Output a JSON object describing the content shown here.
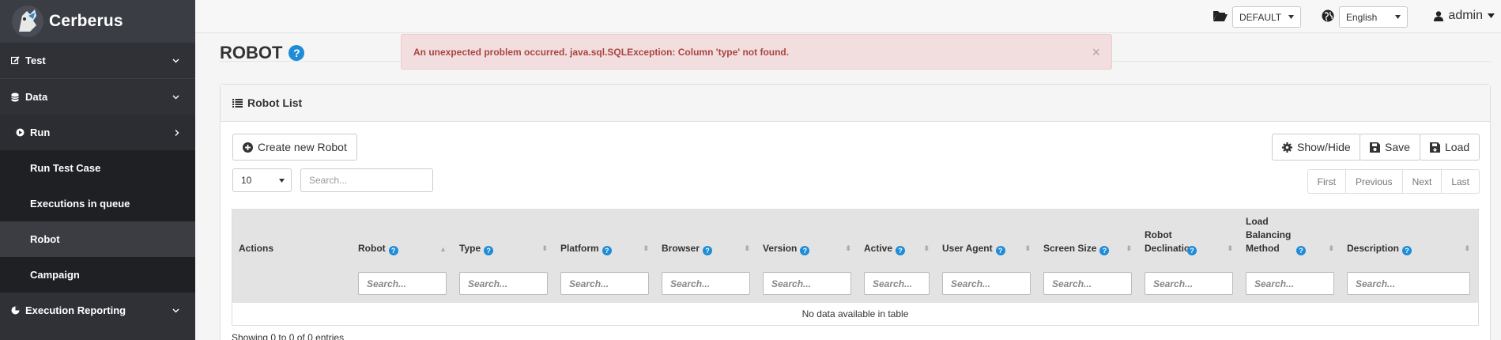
{
  "app": {
    "name": "Cerberus"
  },
  "sidebar": {
    "items": [
      {
        "label": "Test"
      },
      {
        "label": "Data"
      },
      {
        "label": "Run"
      },
      {
        "label": "Run Test Case"
      },
      {
        "label": "Executions in queue"
      },
      {
        "label": "Robot"
      },
      {
        "label": "Campaign"
      },
      {
        "label": "Execution Reporting"
      }
    ]
  },
  "topbar": {
    "system": "DEFAULT",
    "language": "English",
    "user": "admin"
  },
  "page": {
    "title": "ROBOT"
  },
  "alert": {
    "message": "An unexpected problem occurred. java.sql.SQLException: Column 'type' not found.",
    "close": "×"
  },
  "panel": {
    "title": "Robot List",
    "create_button": "Create new Robot",
    "showhide_button": "Show/Hide",
    "save_button": "Save",
    "load_button": "Load",
    "page_size": "10",
    "search_placeholder": "Search...",
    "pager": {
      "first": "First",
      "previous": "Previous",
      "next": "Next",
      "last": "Last"
    }
  },
  "table": {
    "columns": [
      {
        "label": "Actions",
        "help": false
      },
      {
        "label": "Robot",
        "help": true
      },
      {
        "label": "Type",
        "help": true
      },
      {
        "label": "Platform",
        "help": true
      },
      {
        "label": "Browser",
        "help": true
      },
      {
        "label": "Version",
        "help": true
      },
      {
        "label": "Active",
        "help": true
      },
      {
        "label": "User Agent",
        "help": true
      },
      {
        "label": "Screen Size",
        "help": true
      },
      {
        "label": "Robot Declination",
        "help": true
      },
      {
        "label": "Load Balancing Method",
        "help": true
      },
      {
        "label": "Description",
        "help": true
      }
    ],
    "filter_placeholder": "Search...",
    "empty": "No data available in table",
    "info": "Showing 0 to 0 of 0 entries"
  },
  "colors": {
    "sidebar": "#2f3137",
    "accent": "#1e8cd6",
    "alert_bg": "#f2dede",
    "alert_text": "#a94442"
  }
}
